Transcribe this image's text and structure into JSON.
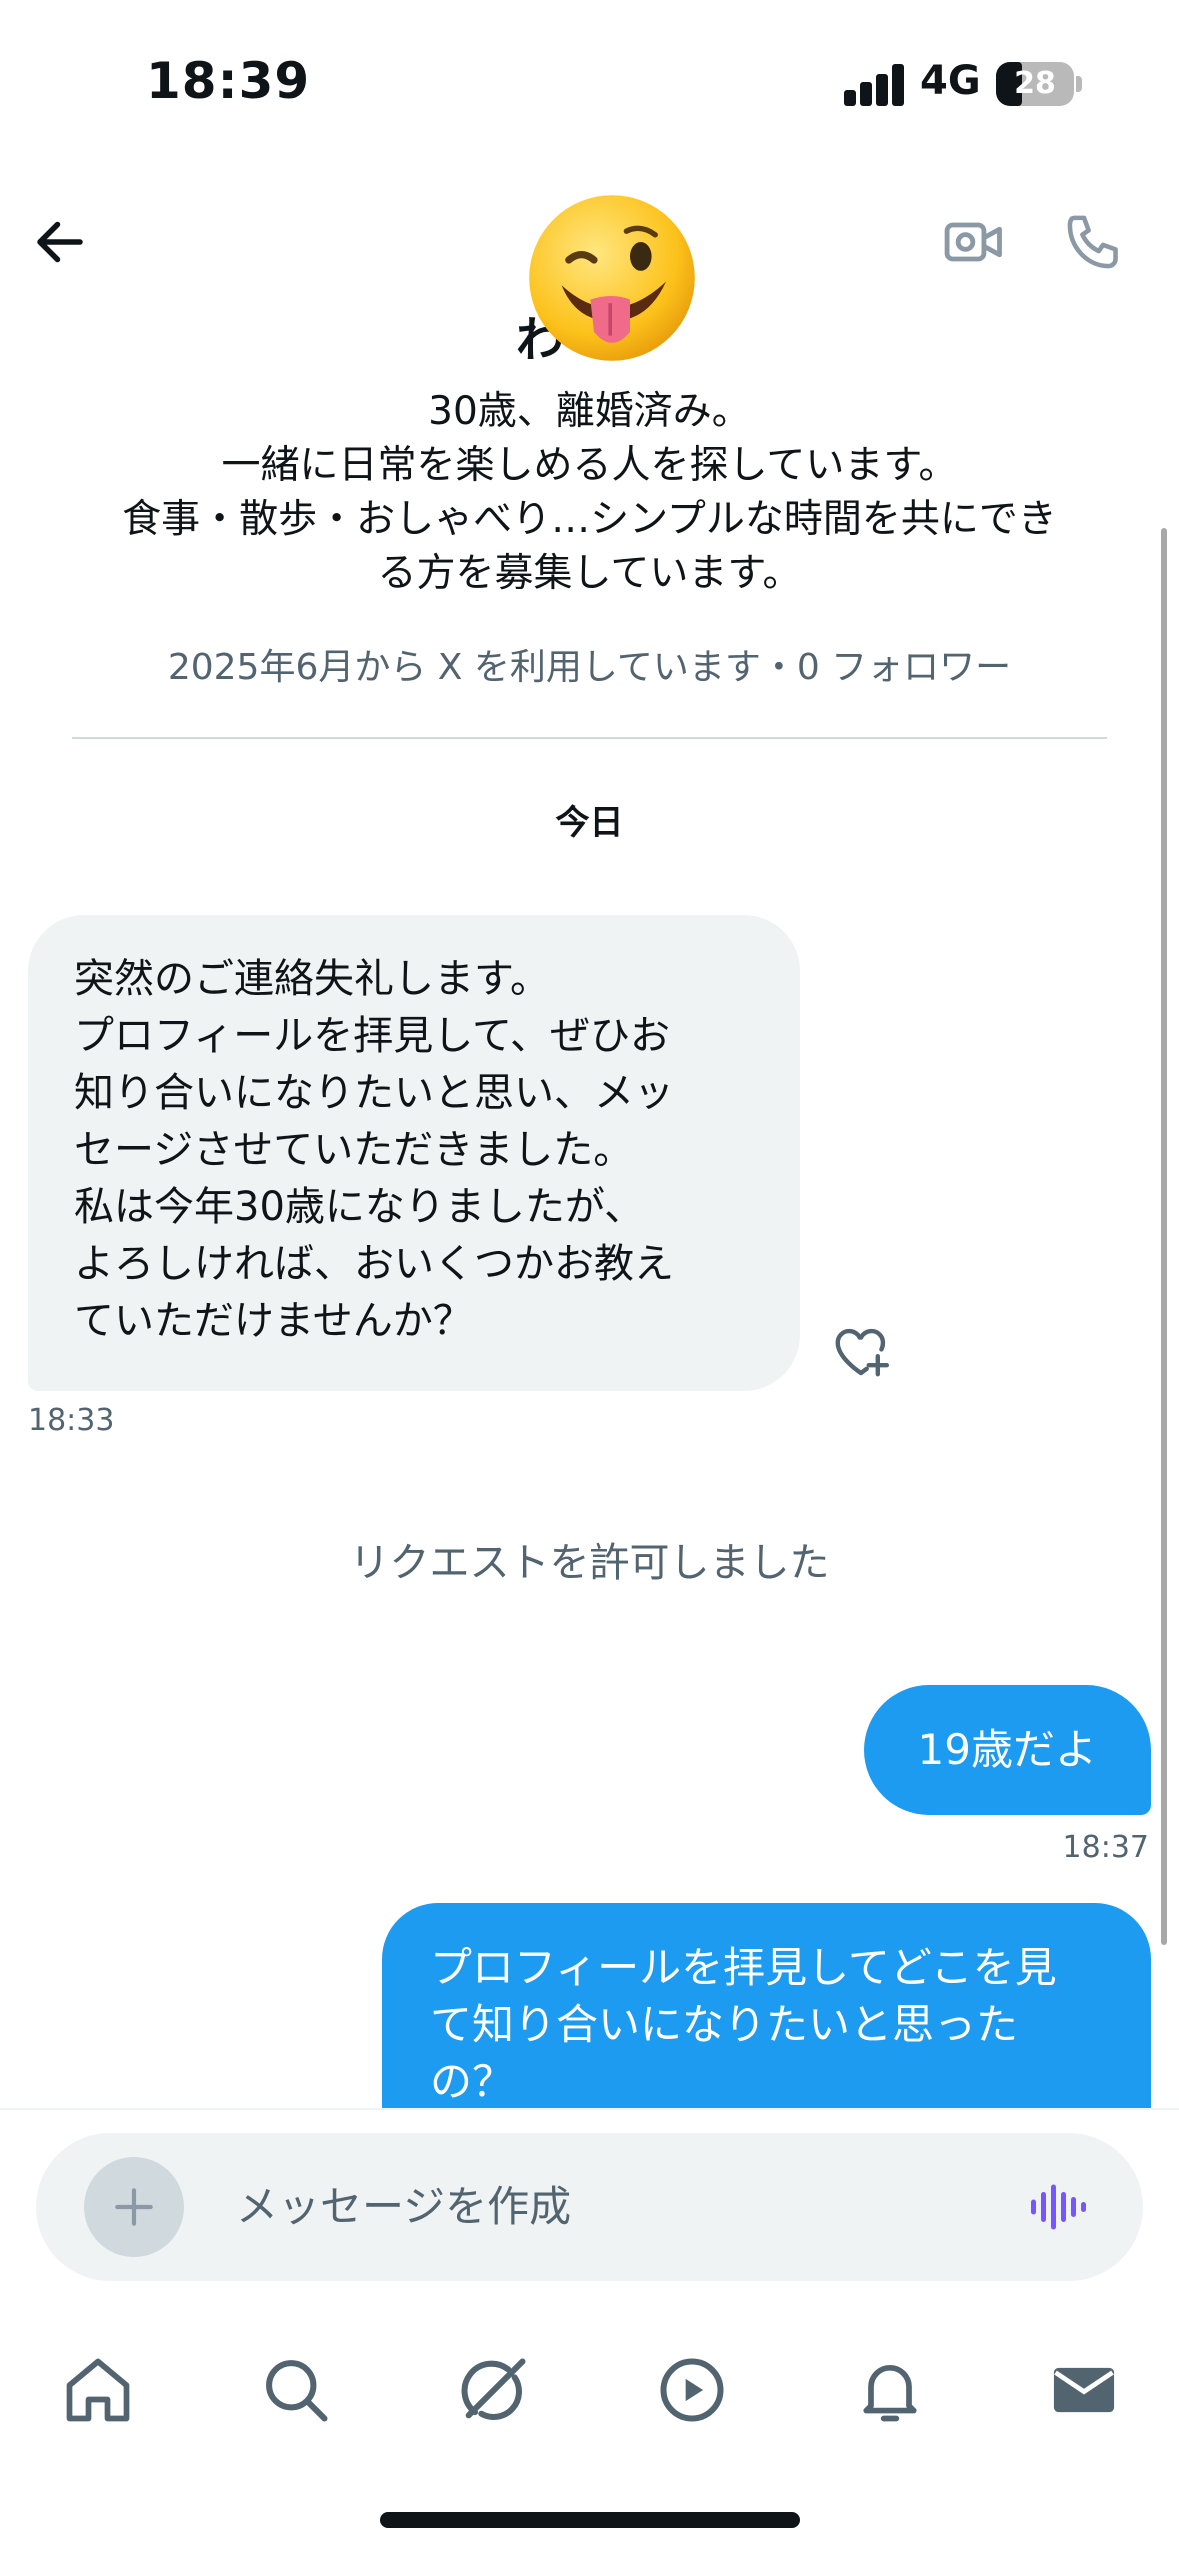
{
  "status_bar": {
    "time": "18:39",
    "network": "4G",
    "battery": "28"
  },
  "profile": {
    "name": "わ",
    "bio": "30歳、離婚済み。\n一緒に日常を楽しめる人を探しています。\n食事・散歩・おしゃべり…シンプルな時間を共にでき\nる方を募集しています。",
    "meta": "2025年6月から X を利用しています・0 フォロワー"
  },
  "conversation": {
    "date_separator": "今日",
    "messages": [
      {
        "direction": "incoming",
        "text": "突然のご連絡失礼します。\nプロフィールを拝見して、ぜひお\n知り合いになりたいと思い、メッ\nセージさせていただきました。\n私は今年30歳になりましたが、\nよろしければ、おいくつかお教え\nていただけませんか？",
        "time": "18:33"
      },
      {
        "direction": "system",
        "text": "リクエストを許可しました"
      },
      {
        "direction": "outgoing",
        "text": "19歳だよ",
        "time": "18:37"
      },
      {
        "direction": "outgoing",
        "text": "プロフィールを拝見してどこを見\nて知り合いになりたいと思った\nの？"
      }
    ]
  },
  "composer": {
    "placeholder": "メッセージを作成"
  },
  "colors": {
    "accent": "#1d9bf0",
    "bubble_incoming": "#eff3f4",
    "secondary_text": "#536471",
    "voice": "#7856ff"
  },
  "icons": {
    "back": "arrow-left-icon",
    "video": "video-camera-icon",
    "call": "phone-icon",
    "avatar": "winking-tongue-emoji",
    "react": "heart-plus-icon",
    "add": "plus-icon",
    "voice": "voice-waveform-icon",
    "tabs": [
      "home-icon",
      "search-icon",
      "grok-icon",
      "play-icon",
      "bell-icon",
      "mail-icon"
    ]
  }
}
